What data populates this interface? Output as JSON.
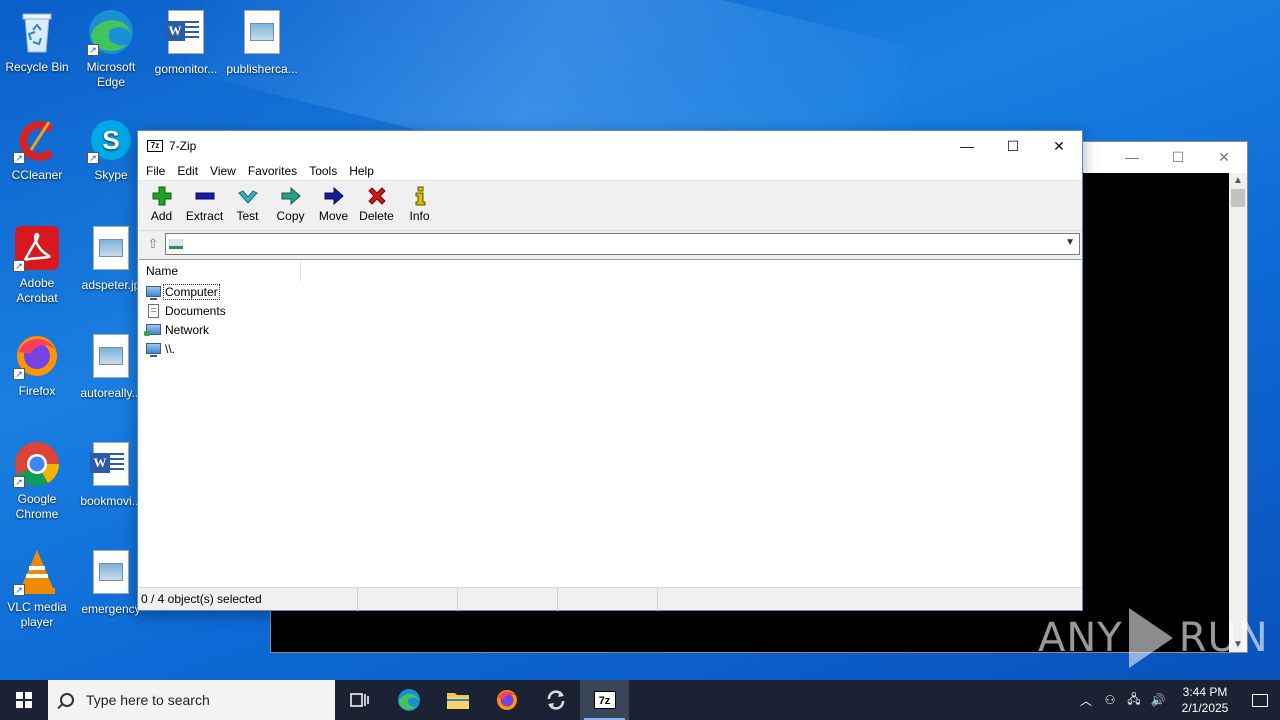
{
  "desktop": {
    "icons": [
      {
        "label": "Recycle Bin"
      },
      {
        "label": "Microsoft Edge"
      },
      {
        "label": "gomonitor..."
      },
      {
        "label": "publisherca..."
      },
      {
        "label": "CCleaner"
      },
      {
        "label": "Skype"
      },
      {
        "label": "Adobe Acrobat"
      },
      {
        "label": "adspeter.jp"
      },
      {
        "label": "Firefox"
      },
      {
        "label": "autoreally..."
      },
      {
        "label": "Google Chrome"
      },
      {
        "label": "bookmovi..."
      },
      {
        "label": "VLC media player"
      },
      {
        "label": "emergency"
      }
    ]
  },
  "window": {
    "title": "7-Zip",
    "app_icon_text": "7z",
    "menu": [
      "File",
      "Edit",
      "View",
      "Favorites",
      "Tools",
      "Help"
    ],
    "toolbar": [
      {
        "label": "Add",
        "icon": "plus-icon",
        "color": "#22a222"
      },
      {
        "label": "Extract",
        "icon": "minus-icon",
        "color": "#1a1aa8"
      },
      {
        "label": "Test",
        "icon": "check-icon",
        "color": "#3ab0c0"
      },
      {
        "label": "Copy",
        "icon": "copy-arrow-icon",
        "color": "#2aa08a"
      },
      {
        "label": "Move",
        "icon": "move-arrow-icon",
        "color": "#1a1a9a"
      },
      {
        "label": "Delete",
        "icon": "x-icon",
        "color": "#d01818"
      },
      {
        "label": "Info",
        "icon": "info-icon",
        "color": "#d8c000"
      }
    ],
    "address": "",
    "list": {
      "columns": [
        "Name"
      ],
      "items": [
        {
          "name": "Computer",
          "icon": "computer-icon"
        },
        {
          "name": "Documents",
          "icon": "documents-icon"
        },
        {
          "name": "Network",
          "icon": "network-icon"
        },
        {
          "name": "\\\\.",
          "icon": "computer-icon"
        }
      ]
    },
    "status": {
      "selected": "0 / 4 object(s) selected",
      "cells": [
        "",
        "",
        ""
      ]
    }
  },
  "watermark": {
    "left": "ANY",
    "right": "RUN"
  },
  "taskbar": {
    "search_placeholder": "Type here to search",
    "time": "3:44 PM",
    "date": "2/1/2025"
  },
  "colors": {
    "accent": "#0a6ad6",
    "taskbar": "#1a2233"
  }
}
